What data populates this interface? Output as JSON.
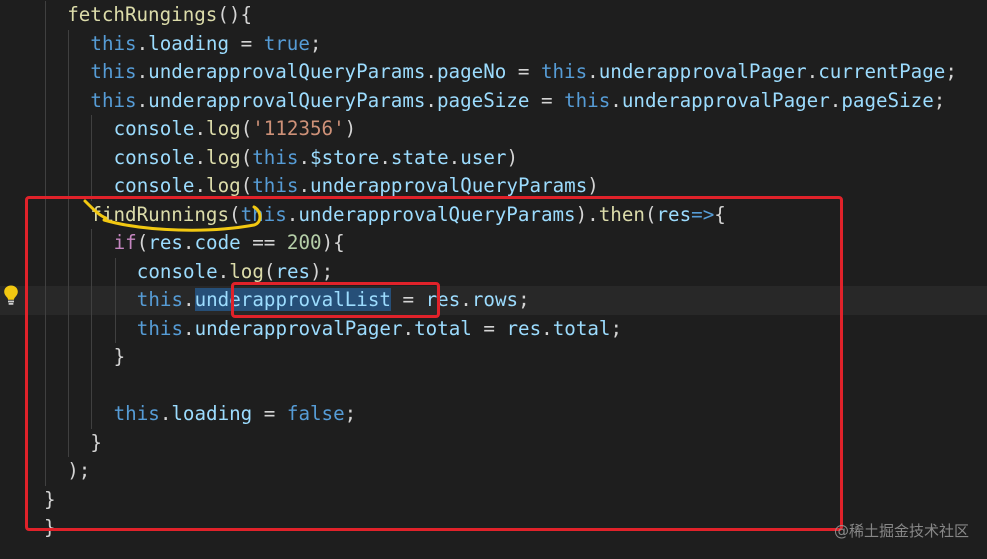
{
  "editor": {
    "theme_colors": {
      "background": "#1e1e1e",
      "function": "#dcdcaa",
      "keyword": "#569cd6",
      "control": "#c586c0",
      "variable": "#9cdcfe",
      "number": "#b5cea8",
      "string": "#ce9178",
      "punctuation": "#d4d4d4",
      "selection": "#264f78"
    },
    "lines": [
      {
        "indent": 1,
        "tokens": [
          [
            "func",
            "fetchRungings"
          ],
          [
            "p",
            "(){"
          ]
        ]
      },
      {
        "indent": 2,
        "tokens": [
          [
            "kw",
            "this"
          ],
          [
            "p",
            "."
          ],
          [
            "var",
            "loading"
          ],
          [
            "p",
            " = "
          ],
          [
            "kw",
            "true"
          ],
          [
            "p",
            ";"
          ]
        ]
      },
      {
        "indent": 2,
        "tokens": [
          [
            "kw",
            "this"
          ],
          [
            "p",
            "."
          ],
          [
            "var",
            "underapprovalQueryParams"
          ],
          [
            "p",
            "."
          ],
          [
            "var",
            "pageNo"
          ],
          [
            "p",
            " = "
          ],
          [
            "kw",
            "this"
          ],
          [
            "p",
            "."
          ],
          [
            "var",
            "underapprovalPager"
          ],
          [
            "p",
            "."
          ],
          [
            "var",
            "currentPage"
          ],
          [
            "p",
            ";"
          ]
        ]
      },
      {
        "indent": 2,
        "tokens": [
          [
            "kw",
            "this"
          ],
          [
            "p",
            "."
          ],
          [
            "var",
            "underapprovalQueryParams"
          ],
          [
            "p",
            "."
          ],
          [
            "var",
            "pageSize"
          ],
          [
            "p",
            " = "
          ],
          [
            "kw",
            "this"
          ],
          [
            "p",
            "."
          ],
          [
            "var",
            "underapprovalPager"
          ],
          [
            "p",
            "."
          ],
          [
            "var",
            "pageSize"
          ],
          [
            "p",
            ";"
          ]
        ]
      },
      {
        "indent": 3,
        "tokens": [
          [
            "var",
            "console"
          ],
          [
            "p",
            "."
          ],
          [
            "func",
            "log"
          ],
          [
            "p",
            "("
          ],
          [
            "str",
            "'112356'"
          ],
          [
            "p",
            ")"
          ]
        ]
      },
      {
        "indent": 3,
        "tokens": [
          [
            "var",
            "console"
          ],
          [
            "p",
            "."
          ],
          [
            "func",
            "log"
          ],
          [
            "p",
            "("
          ],
          [
            "kw",
            "this"
          ],
          [
            "p",
            "."
          ],
          [
            "var",
            "$store"
          ],
          [
            "p",
            "."
          ],
          [
            "var",
            "state"
          ],
          [
            "p",
            "."
          ],
          [
            "var",
            "user"
          ],
          [
            "p",
            ")"
          ]
        ]
      },
      {
        "indent": 3,
        "tokens": [
          [
            "var",
            "console"
          ],
          [
            "p",
            "."
          ],
          [
            "func",
            "log"
          ],
          [
            "p",
            "("
          ],
          [
            "kw",
            "this"
          ],
          [
            "p",
            "."
          ],
          [
            "var",
            "underapprovalQueryParams"
          ],
          [
            "p",
            ")"
          ]
        ]
      },
      {
        "indent": 2,
        "tokens": [
          [
            "func",
            "findRunnings"
          ],
          [
            "p",
            "("
          ],
          [
            "kw",
            "this"
          ],
          [
            "p",
            "."
          ],
          [
            "var",
            "underapprovalQueryParams"
          ],
          [
            "p",
            ")."
          ],
          [
            "func",
            "then"
          ],
          [
            "p",
            "("
          ],
          [
            "var",
            "res"
          ],
          [
            "kw",
            "=>"
          ],
          [
            "p",
            "{"
          ]
        ]
      },
      {
        "indent": 3,
        "tokens": [
          [
            "ctrl",
            "if"
          ],
          [
            "p",
            "("
          ],
          [
            "var",
            "res"
          ],
          [
            "p",
            "."
          ],
          [
            "var",
            "code"
          ],
          [
            "p",
            " == "
          ],
          [
            "num",
            "200"
          ],
          [
            "p",
            "){"
          ]
        ]
      },
      {
        "indent": 4,
        "tokens": [
          [
            "var",
            "console"
          ],
          [
            "p",
            "."
          ],
          [
            "func",
            "log"
          ],
          [
            "p",
            "("
          ],
          [
            "var",
            "res"
          ],
          [
            "p",
            ");"
          ]
        ]
      },
      {
        "indent": 4,
        "current": true,
        "tokens": [
          [
            "kw",
            "this"
          ],
          [
            "p",
            "."
          ],
          [
            "var",
            "underapprovalList",
            "sel"
          ],
          [
            "p",
            " = "
          ],
          [
            "var",
            "res"
          ],
          [
            "p",
            "."
          ],
          [
            "var",
            "rows"
          ],
          [
            "p",
            ";"
          ]
        ]
      },
      {
        "indent": 4,
        "tokens": [
          [
            "kw",
            "this"
          ],
          [
            "p",
            "."
          ],
          [
            "var",
            "underapprovalPager"
          ],
          [
            "p",
            "."
          ],
          [
            "var",
            "total"
          ],
          [
            "p",
            " = "
          ],
          [
            "var",
            "res"
          ],
          [
            "p",
            "."
          ],
          [
            "var",
            "total"
          ],
          [
            "p",
            ";"
          ]
        ]
      },
      {
        "indent": 3,
        "tokens": [
          [
            "p",
            "}"
          ]
        ]
      },
      {
        "indent": 3,
        "tokens": []
      },
      {
        "indent": 3,
        "tokens": [
          [
            "kw",
            "this"
          ],
          [
            "p",
            "."
          ],
          [
            "var",
            "loading"
          ],
          [
            "p",
            " = "
          ],
          [
            "kw",
            "false"
          ],
          [
            "p",
            ";"
          ]
        ]
      },
      {
        "indent": 2,
        "tokens": [
          [
            "p",
            "}"
          ]
        ]
      },
      {
        "indent": 1,
        "tokens": [
          [
            "p",
            ");"
          ]
        ]
      },
      {
        "indent": 0,
        "tokens": [
          [
            "p",
            "}"
          ]
        ]
      },
      {
        "indent": 0,
        "tokens": [
          [
            "p",
            "}"
          ]
        ]
      }
    ],
    "lightbulb_icon": "lightbulb-icon",
    "annotations": {
      "big_box_color": "#e0222a",
      "small_box_color": "#e0222a",
      "underline_color": "#f2c811"
    }
  },
  "watermark": {
    "text": "@稀土掘金技术社区"
  }
}
